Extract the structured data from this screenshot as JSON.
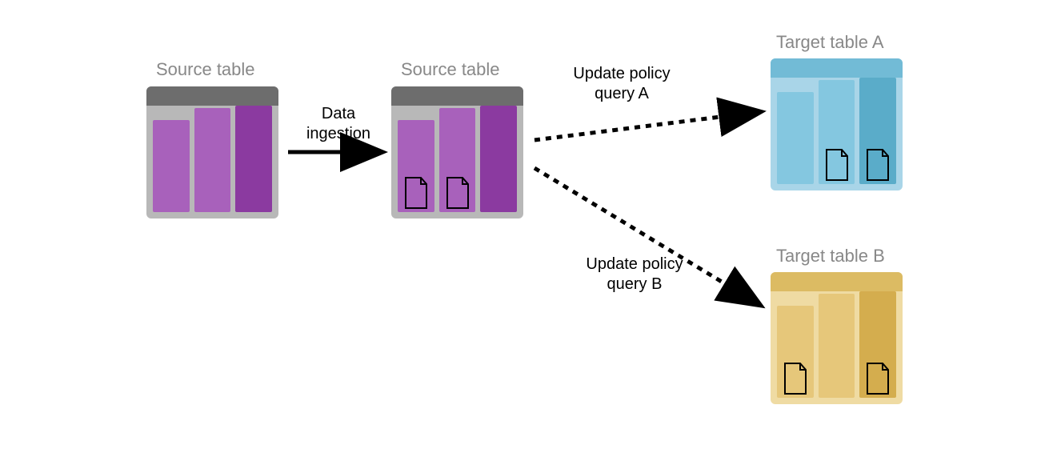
{
  "nodes": {
    "source1": {
      "label": "Source table"
    },
    "source2": {
      "label": "Source table"
    },
    "targetA": {
      "label": "Target table A"
    },
    "targetB": {
      "label": "Target table B"
    }
  },
  "arrows": {
    "ingestion": {
      "label_line1": "Data",
      "label_line2": "ingestion"
    },
    "policyA": {
      "label_line1": "Update policy",
      "label_line2": "query A"
    },
    "policyB": {
      "label_line1": "Update policy",
      "label_line2": "query B"
    }
  }
}
